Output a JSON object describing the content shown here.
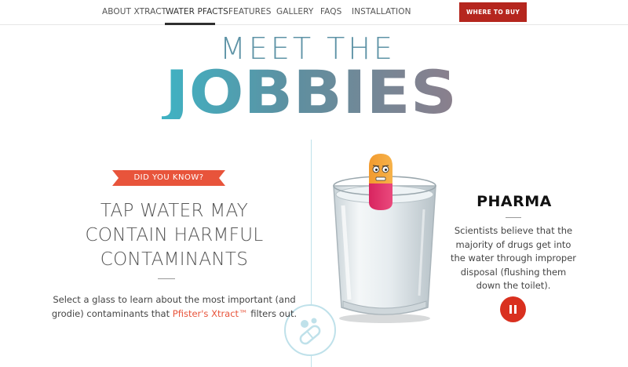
{
  "nav": {
    "items": [
      {
        "label": "ABOUT XTRACT"
      },
      {
        "label": "WATER PFACTS",
        "active": true
      },
      {
        "label": "FEATURES"
      },
      {
        "label": "GALLERY"
      },
      {
        "label": "FAQS"
      },
      {
        "label": "INSTALLATION"
      }
    ],
    "buy_label": "WHERE TO BUY"
  },
  "hero": {
    "line1": "MEET THE",
    "line2": "JOBBIES"
  },
  "left": {
    "badge": "DID YOU KNOW?",
    "headline": [
      "TAP WATER MAY",
      "CONTAIN HARMFUL",
      "CONTAMINANTS"
    ],
    "body_pre": "Select a glass to learn about the most important (and grodie) contaminants that ",
    "body_link": "Pfister's Xtract™",
    "body_post": " filters out."
  },
  "right": {
    "title": "PHARMA",
    "body": "Scientists believe that the majority of drugs get into the water through improper disposal (flushing them down the toilet)."
  },
  "icons": {
    "pill_circle": "pills-icon",
    "pause": "pause-icon"
  },
  "colors": {
    "brand_red": "#b5261e",
    "accent_orange": "#e8543b",
    "teal": "#5e93a6",
    "pause_red": "#d9301f"
  }
}
